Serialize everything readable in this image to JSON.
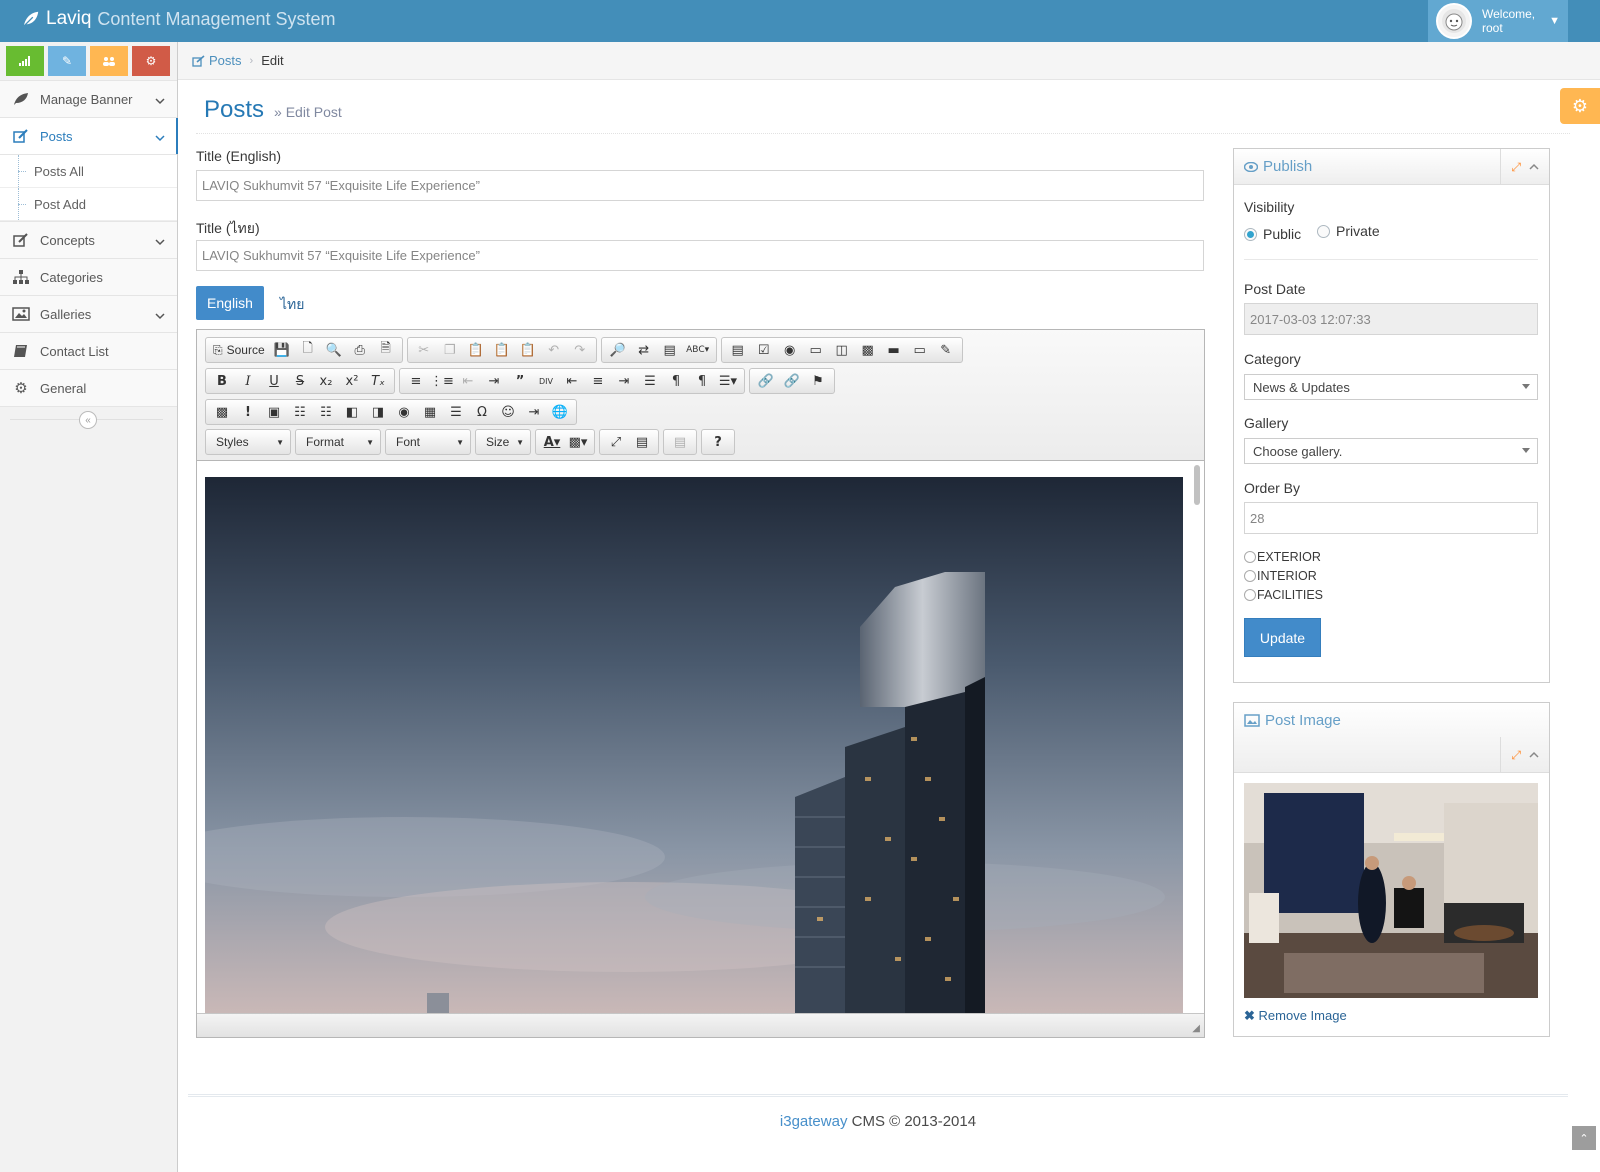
{
  "navbar": {
    "brand": "Laviq",
    "brand_sub": "Content Management System",
    "welcome": "Welcome,",
    "username": "root"
  },
  "sidebar": {
    "shortcuts": [
      {
        "icon": "signal-icon",
        "color": "#68bc31"
      },
      {
        "icon": "pencil-icon",
        "color": "#6fb3e0"
      },
      {
        "icon": "users-icon",
        "color": "#ffb752"
      },
      {
        "icon": "cogs-icon",
        "color": "#d15b47"
      }
    ],
    "items": [
      {
        "label": "Manage Banner",
        "icon": "leaf-icon"
      },
      {
        "label": "Posts",
        "icon": "edit-icon"
      },
      {
        "label": "Concepts",
        "icon": "edit-icon"
      },
      {
        "label": "Categories",
        "icon": "sitemap-icon"
      },
      {
        "label": "Galleries",
        "icon": "picture-icon"
      },
      {
        "label": "Contact List",
        "icon": "book-icon"
      },
      {
        "label": "General",
        "icon": "cogs-icon"
      }
    ],
    "posts_submenu": [
      "Posts All",
      "Post Add"
    ]
  },
  "breadcrumb": {
    "parent": "Posts",
    "current": "Edit"
  },
  "page": {
    "title": "Posts",
    "subtitle": "Edit Post"
  },
  "form": {
    "title_en_label": "Title (English)",
    "title_en_value": "LAVIQ Sukhumvit 57 “Exquisite Life Experience”",
    "title_th_label": "Title (ไทย)",
    "title_th_value": "LAVIQ Sukhumvit 57 “Exquisite Life Experience”",
    "tab_en": "English",
    "tab_th": "ไทย"
  },
  "editor": {
    "source_label": "Source",
    "combos": [
      "Styles",
      "Format",
      "Font",
      "Size"
    ]
  },
  "publish": {
    "title": "Publish",
    "visibility_label": "Visibility",
    "public": "Public",
    "private": "Private",
    "post_date_label": "Post Date",
    "post_date": "2017-03-03 12:07:33",
    "category_label": "Category",
    "category": "News & Updates",
    "gallery_label": "Gallery",
    "gallery": "Choose gallery.",
    "order_label": "Order By",
    "order": "28",
    "tags": [
      "EXTERIOR",
      "INTERIOR",
      "FACILITIES"
    ],
    "update": "Update"
  },
  "post_image": {
    "title": "Post Image",
    "remove": "Remove Image"
  },
  "footer": {
    "brand": "i3gateway",
    "text": " CMS © 2013-2014"
  }
}
